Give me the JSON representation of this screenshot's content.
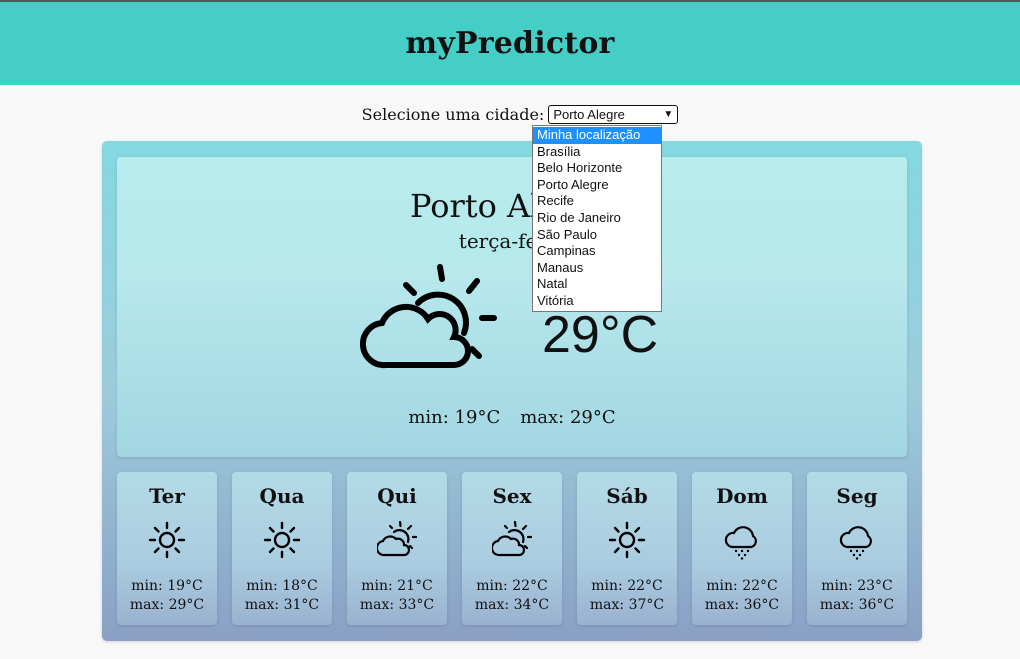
{
  "app": {
    "title": "myPredictor"
  },
  "selector": {
    "label": "Selecione uma cidade:",
    "selected": "Porto Alegre",
    "options": [
      "Minha localização",
      "Brasília",
      "Belo Horizonte",
      "Porto Alegre",
      "Recife",
      "Rio de Janeiro",
      "São Paulo",
      "Campinas",
      "Manaus",
      "Natal",
      "Vitória"
    ],
    "highlighted": "Minha localização"
  },
  "current": {
    "city": "Porto Alegre",
    "day": "terça-feira",
    "icon": "partly-cloudy-icon",
    "temperature": "29°C",
    "min": "min: 19°C",
    "max": "max: 29°C"
  },
  "forecast": [
    {
      "day": "Ter",
      "icon": "sun-icon",
      "min": "min: 19°C",
      "max": "max: 29°C"
    },
    {
      "day": "Qua",
      "icon": "sun-icon",
      "min": "min: 18°C",
      "max": "max: 31°C"
    },
    {
      "day": "Qui",
      "icon": "partly-cloudy-icon",
      "min": "min: 21°C",
      "max": "max: 33°C"
    },
    {
      "day": "Sex",
      "icon": "partly-cloudy-icon",
      "min": "min: 22°C",
      "max": "max: 34°C"
    },
    {
      "day": "Sáb",
      "icon": "sun-icon",
      "min": "min: 22°C",
      "max": "max: 37°C"
    },
    {
      "day": "Dom",
      "icon": "rain-cloud-icon",
      "min": "min: 22°C",
      "max": "max: 36°C"
    },
    {
      "day": "Seg",
      "icon": "rain-cloud-icon",
      "min": "min: 23°C",
      "max": "max: 36°C"
    }
  ],
  "colors": {
    "header": "#45cec6",
    "accent": "#1e90ff"
  }
}
